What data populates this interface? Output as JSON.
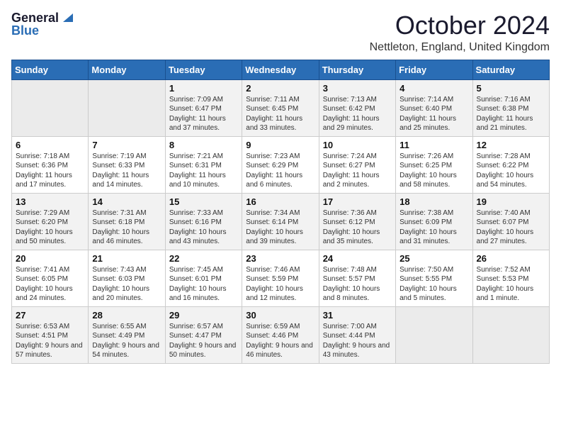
{
  "logo": {
    "general": "General",
    "blue": "Blue"
  },
  "title": "October 2024",
  "location": "Nettleton, England, United Kingdom",
  "days_of_week": [
    "Sunday",
    "Monday",
    "Tuesday",
    "Wednesday",
    "Thursday",
    "Friday",
    "Saturday"
  ],
  "weeks": [
    [
      {
        "day": "",
        "sunrise": "",
        "sunset": "",
        "daylight": ""
      },
      {
        "day": "",
        "sunrise": "",
        "sunset": "",
        "daylight": ""
      },
      {
        "day": "1",
        "sunrise": "Sunrise: 7:09 AM",
        "sunset": "Sunset: 6:47 PM",
        "daylight": "Daylight: 11 hours and 37 minutes."
      },
      {
        "day": "2",
        "sunrise": "Sunrise: 7:11 AM",
        "sunset": "Sunset: 6:45 PM",
        "daylight": "Daylight: 11 hours and 33 minutes."
      },
      {
        "day": "3",
        "sunrise": "Sunrise: 7:13 AM",
        "sunset": "Sunset: 6:42 PM",
        "daylight": "Daylight: 11 hours and 29 minutes."
      },
      {
        "day": "4",
        "sunrise": "Sunrise: 7:14 AM",
        "sunset": "Sunset: 6:40 PM",
        "daylight": "Daylight: 11 hours and 25 minutes."
      },
      {
        "day": "5",
        "sunrise": "Sunrise: 7:16 AM",
        "sunset": "Sunset: 6:38 PM",
        "daylight": "Daylight: 11 hours and 21 minutes."
      }
    ],
    [
      {
        "day": "6",
        "sunrise": "Sunrise: 7:18 AM",
        "sunset": "Sunset: 6:36 PM",
        "daylight": "Daylight: 11 hours and 17 minutes."
      },
      {
        "day": "7",
        "sunrise": "Sunrise: 7:19 AM",
        "sunset": "Sunset: 6:33 PM",
        "daylight": "Daylight: 11 hours and 14 minutes."
      },
      {
        "day": "8",
        "sunrise": "Sunrise: 7:21 AM",
        "sunset": "Sunset: 6:31 PM",
        "daylight": "Daylight: 11 hours and 10 minutes."
      },
      {
        "day": "9",
        "sunrise": "Sunrise: 7:23 AM",
        "sunset": "Sunset: 6:29 PM",
        "daylight": "Daylight: 11 hours and 6 minutes."
      },
      {
        "day": "10",
        "sunrise": "Sunrise: 7:24 AM",
        "sunset": "Sunset: 6:27 PM",
        "daylight": "Daylight: 11 hours and 2 minutes."
      },
      {
        "day": "11",
        "sunrise": "Sunrise: 7:26 AM",
        "sunset": "Sunset: 6:25 PM",
        "daylight": "Daylight: 10 hours and 58 minutes."
      },
      {
        "day": "12",
        "sunrise": "Sunrise: 7:28 AM",
        "sunset": "Sunset: 6:22 PM",
        "daylight": "Daylight: 10 hours and 54 minutes."
      }
    ],
    [
      {
        "day": "13",
        "sunrise": "Sunrise: 7:29 AM",
        "sunset": "Sunset: 6:20 PM",
        "daylight": "Daylight: 10 hours and 50 minutes."
      },
      {
        "day": "14",
        "sunrise": "Sunrise: 7:31 AM",
        "sunset": "Sunset: 6:18 PM",
        "daylight": "Daylight: 10 hours and 46 minutes."
      },
      {
        "day": "15",
        "sunrise": "Sunrise: 7:33 AM",
        "sunset": "Sunset: 6:16 PM",
        "daylight": "Daylight: 10 hours and 43 minutes."
      },
      {
        "day": "16",
        "sunrise": "Sunrise: 7:34 AM",
        "sunset": "Sunset: 6:14 PM",
        "daylight": "Daylight: 10 hours and 39 minutes."
      },
      {
        "day": "17",
        "sunrise": "Sunrise: 7:36 AM",
        "sunset": "Sunset: 6:12 PM",
        "daylight": "Daylight: 10 hours and 35 minutes."
      },
      {
        "day": "18",
        "sunrise": "Sunrise: 7:38 AM",
        "sunset": "Sunset: 6:09 PM",
        "daylight": "Daylight: 10 hours and 31 minutes."
      },
      {
        "day": "19",
        "sunrise": "Sunrise: 7:40 AM",
        "sunset": "Sunset: 6:07 PM",
        "daylight": "Daylight: 10 hours and 27 minutes."
      }
    ],
    [
      {
        "day": "20",
        "sunrise": "Sunrise: 7:41 AM",
        "sunset": "Sunset: 6:05 PM",
        "daylight": "Daylight: 10 hours and 24 minutes."
      },
      {
        "day": "21",
        "sunrise": "Sunrise: 7:43 AM",
        "sunset": "Sunset: 6:03 PM",
        "daylight": "Daylight: 10 hours and 20 minutes."
      },
      {
        "day": "22",
        "sunrise": "Sunrise: 7:45 AM",
        "sunset": "Sunset: 6:01 PM",
        "daylight": "Daylight: 10 hours and 16 minutes."
      },
      {
        "day": "23",
        "sunrise": "Sunrise: 7:46 AM",
        "sunset": "Sunset: 5:59 PM",
        "daylight": "Daylight: 10 hours and 12 minutes."
      },
      {
        "day": "24",
        "sunrise": "Sunrise: 7:48 AM",
        "sunset": "Sunset: 5:57 PM",
        "daylight": "Daylight: 10 hours and 8 minutes."
      },
      {
        "day": "25",
        "sunrise": "Sunrise: 7:50 AM",
        "sunset": "Sunset: 5:55 PM",
        "daylight": "Daylight: 10 hours and 5 minutes."
      },
      {
        "day": "26",
        "sunrise": "Sunrise: 7:52 AM",
        "sunset": "Sunset: 5:53 PM",
        "daylight": "Daylight: 10 hours and 1 minute."
      }
    ],
    [
      {
        "day": "27",
        "sunrise": "Sunrise: 6:53 AM",
        "sunset": "Sunset: 4:51 PM",
        "daylight": "Daylight: 9 hours and 57 minutes."
      },
      {
        "day": "28",
        "sunrise": "Sunrise: 6:55 AM",
        "sunset": "Sunset: 4:49 PM",
        "daylight": "Daylight: 9 hours and 54 minutes."
      },
      {
        "day": "29",
        "sunrise": "Sunrise: 6:57 AM",
        "sunset": "Sunset: 4:47 PM",
        "daylight": "Daylight: 9 hours and 50 minutes."
      },
      {
        "day": "30",
        "sunrise": "Sunrise: 6:59 AM",
        "sunset": "Sunset: 4:46 PM",
        "daylight": "Daylight: 9 hours and 46 minutes."
      },
      {
        "day": "31",
        "sunrise": "Sunrise: 7:00 AM",
        "sunset": "Sunset: 4:44 PM",
        "daylight": "Daylight: 9 hours and 43 minutes."
      },
      {
        "day": "",
        "sunrise": "",
        "sunset": "",
        "daylight": ""
      },
      {
        "day": "",
        "sunrise": "",
        "sunset": "",
        "daylight": ""
      }
    ]
  ]
}
